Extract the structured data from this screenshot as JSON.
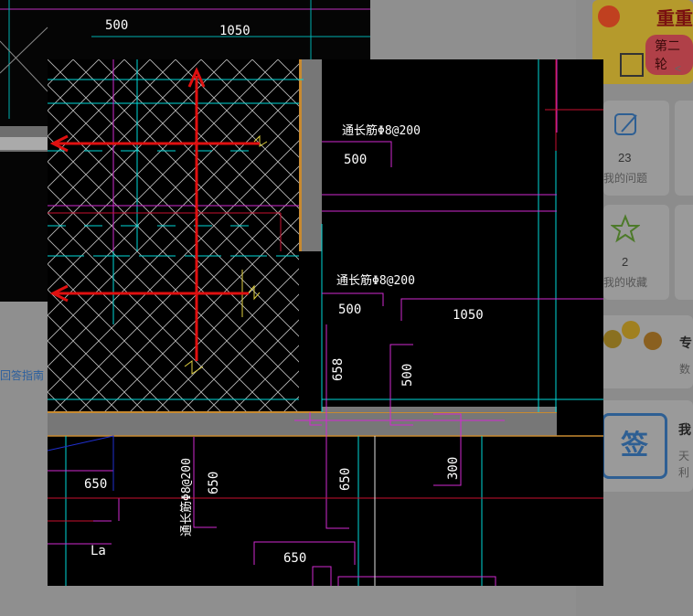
{
  "background_page": {
    "answer_guide_link": "回答指南",
    "banner": {
      "title": "重重好",
      "subtitle": "第二轮"
    },
    "stats": [
      {
        "count": "23",
        "label": "我的问题",
        "icon": "edit-icon"
      },
      {
        "count": "2",
        "label": "我的收藏",
        "icon": "star-icon"
      }
    ],
    "expert_section": {
      "title": "专",
      "subtitle": "数"
    },
    "signin_section": {
      "icon_text": "签",
      "title": "我",
      "line1": "天",
      "line2": "利"
    }
  },
  "cad_behind": {
    "dims": [
      "500",
      "1050"
    ]
  },
  "cad_drawing": {
    "rebar_labels": [
      "通长筋Φ8@200",
      "通长筋Φ8@200",
      "通长筋Φ8@200"
    ],
    "dimensions": {
      "d500_top": "500",
      "d500_mid": "500",
      "d1050": "1050",
      "d658": "658",
      "d500_vert": "500",
      "d300": "300",
      "d650_left": "650",
      "d650_vert1": "650",
      "d650_vert2": "650",
      "d650_bottom": "650",
      "la": "La"
    },
    "colors": {
      "arrow": "#e01010",
      "cyan": "#00e5e5",
      "magenta": "#e030e0",
      "red_line": "#d01030",
      "hatch": "#bfbfbf",
      "wall": "#9a9a9a"
    }
  }
}
